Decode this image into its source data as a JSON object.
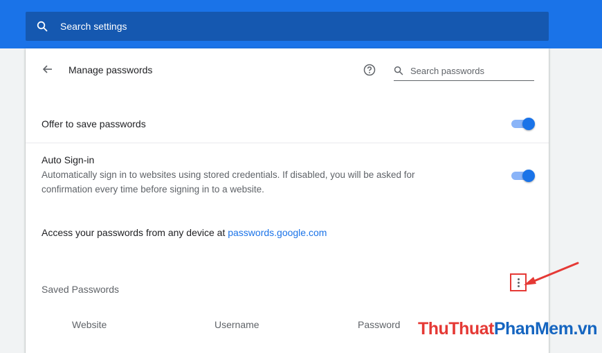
{
  "topbar": {
    "search_label": "Search settings",
    "icon": "search-icon"
  },
  "header": {
    "back_icon": "arrow-back-icon",
    "title": "Manage passwords",
    "help_icon": "help-circle-icon",
    "search_placeholder": "Search passwords"
  },
  "settings": {
    "offer_label": "Offer to save passwords",
    "offer_enabled": true,
    "autosignin_title": "Auto Sign-in",
    "autosignin_desc": "Automatically sign in to websites using stored credentials. If disabled, you will be asked for confirmation every time before signing in to a website.",
    "autosignin_enabled": true,
    "access_text": "Access your passwords from any device at ",
    "access_link": "passwords.google.com"
  },
  "saved": {
    "title": "Saved Passwords",
    "more_icon": "more-vert-icon",
    "columns": [
      "Website",
      "Username",
      "Password"
    ]
  },
  "watermark": {
    "part1": "ThuThuat",
    "part2": "PhanMem",
    "part3": ".vn"
  },
  "colors": {
    "accent": "#1a73e8",
    "annotation": "#e53935"
  }
}
